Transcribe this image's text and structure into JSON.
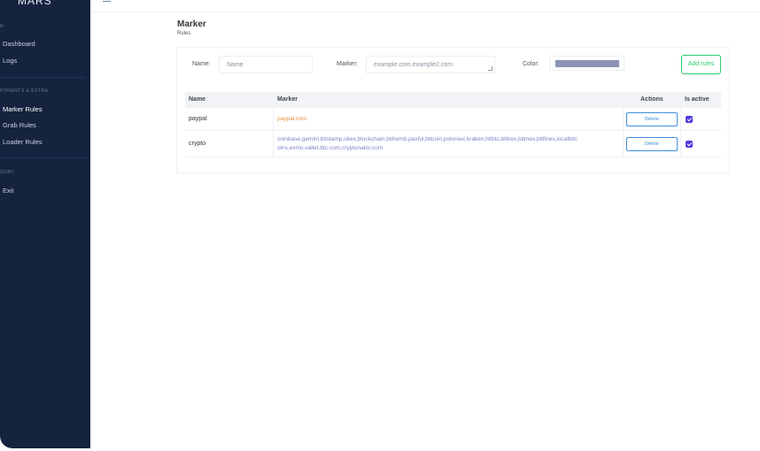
{
  "sidebar": {
    "brand": "MARS",
    "section_main": "N",
    "items_main": [
      {
        "label": "Dashboard"
      },
      {
        "label": "Logs"
      }
    ],
    "section_components": "PONENTS & EXTRA",
    "items_components": [
      {
        "label": "Marker Rules",
        "active": true
      },
      {
        "label": "Grab Rules"
      },
      {
        "label": "Loader Rules"
      }
    ],
    "section_account": "OUNT",
    "items_account": [
      {
        "label": "Exit"
      }
    ]
  },
  "page": {
    "title": "Marker",
    "subtitle": "Rules"
  },
  "form": {
    "name_label": "Name:",
    "name_placeholder": "Name",
    "marker_label": "Marker:",
    "marker_placeholder": "example.com,example2.com",
    "color_label": "Color:",
    "color_value": "#8c93b8",
    "add_button": "Add rules"
  },
  "table": {
    "headers": {
      "name": "Name",
      "marker": "Marker",
      "actions": "Actions",
      "is_active": "Is active"
    },
    "rows": [
      {
        "name": "paypal",
        "marker": "paypal.com",
        "marker_color": "#e8913a",
        "action": "Delete",
        "active": true
      },
      {
        "name": "crypto",
        "marker_line1": "coinbase,gemini,bitstamp,okex,blockchain,bithumb,paxful,bitcoin,poloniex,kraken,hitbtc,bittrex,bitmex,bitfinex,localbitc",
        "marker_line2": "oins,exmo,vallet.btc.com,cryptonator.com",
        "marker_color": "#7b83c9",
        "action": "Delete",
        "active": true
      }
    ]
  },
  "colors": {
    "sidebar_bg": "#15233f",
    "accent_green": "#2ecc71",
    "accent_blue": "#3f8fd9",
    "checkbox": "#4a3bdc"
  }
}
